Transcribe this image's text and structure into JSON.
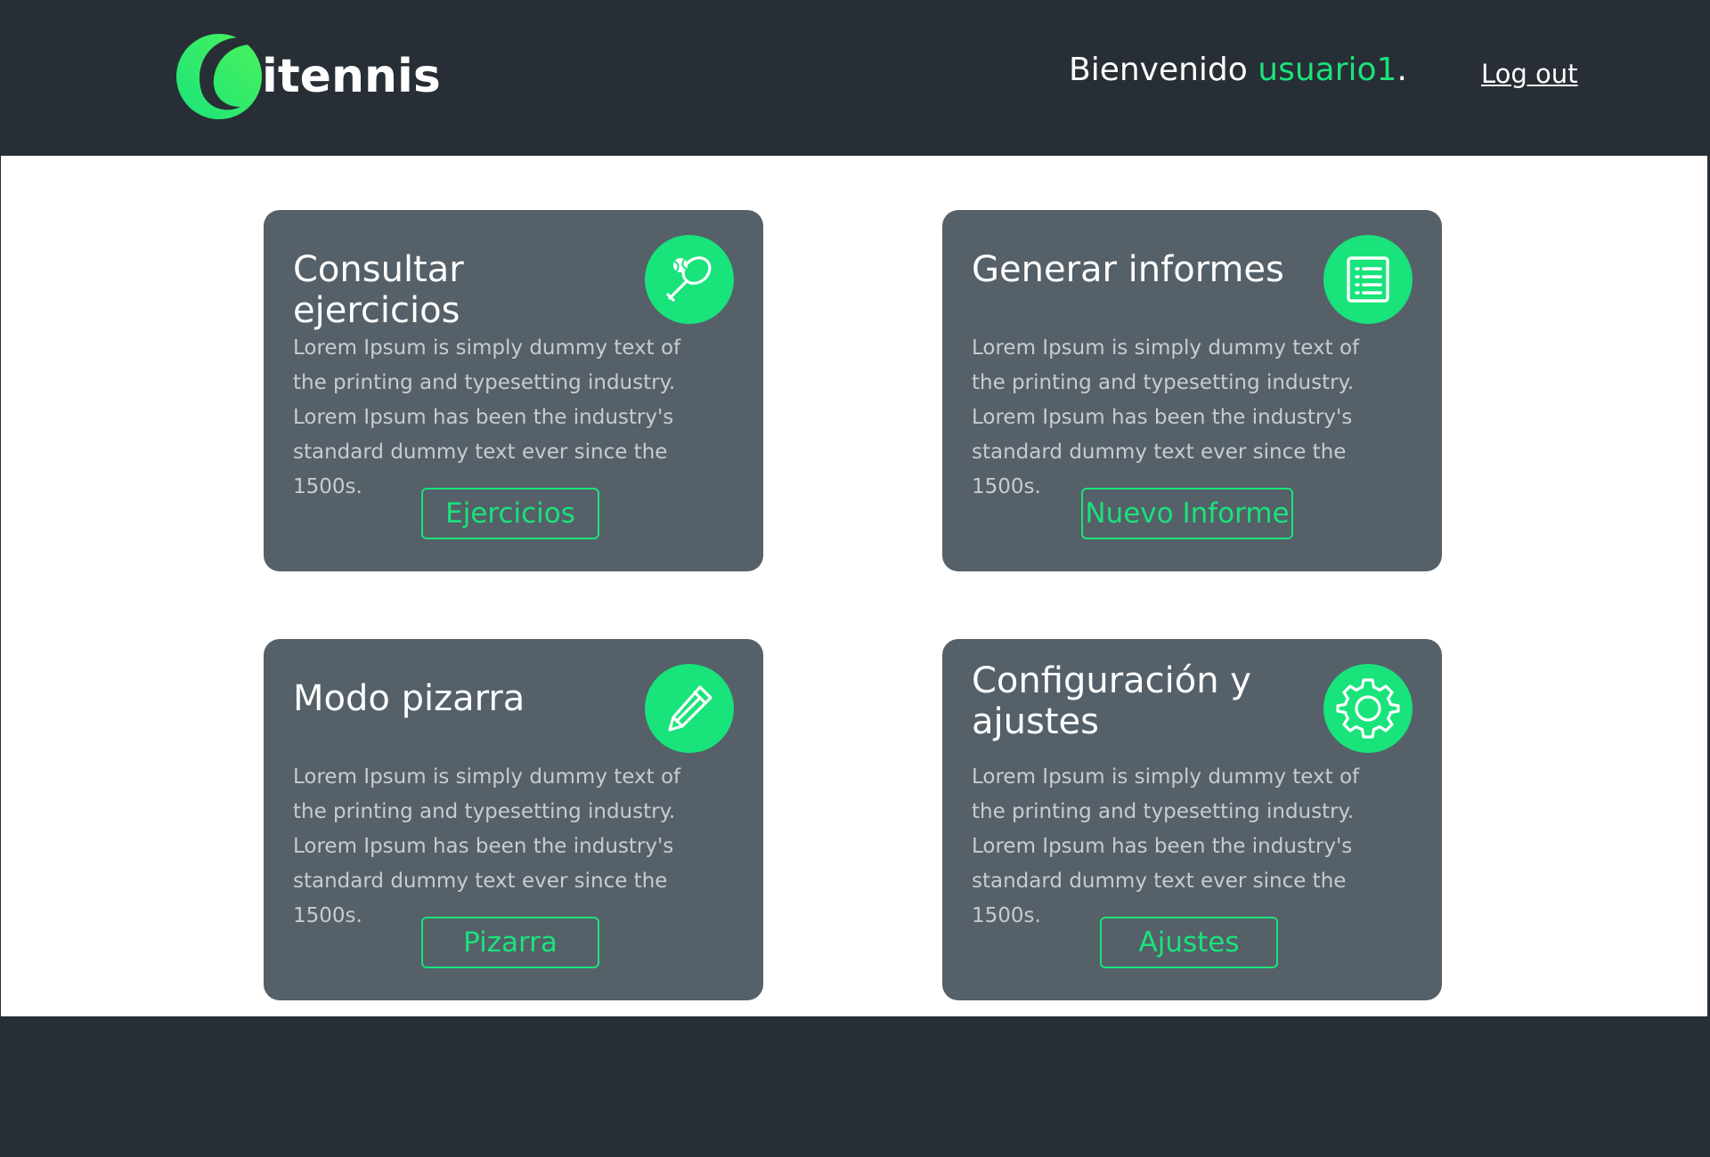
{
  "header": {
    "logo_text": "itennis",
    "welcome_prefix": "Bienvenido ",
    "username": "usuario1",
    "welcome_suffix": ".",
    "logout_label": "Log out"
  },
  "cards": [
    {
      "title": "Consultar ejercicios",
      "icon": "tennis-racket-icon",
      "description": "Lorem Ipsum is simply dummy text of the printing and typesetting industry. Lorem Ipsum has been the industry's standard dummy text ever since the 1500s.",
      "button_label": "Ejercicios"
    },
    {
      "title": "Generar informes",
      "icon": "report-list-icon",
      "description": "Lorem Ipsum is simply dummy text of the printing and typesetting industry. Lorem Ipsum has been the industry's standard dummy text ever since the 1500s.",
      "button_label": "Nuevo Informe"
    },
    {
      "title": "Modo pizarra",
      "icon": "pencil-icon",
      "description": "Lorem Ipsum is simply dummy text of the printing and typesetting industry. Lorem Ipsum has been the industry's standard dummy text ever since the 1500s.",
      "button_label": "Pizarra"
    },
    {
      "title": "Configuración y ajustes",
      "icon": "gear-icon",
      "description": "Lorem Ipsum is simply dummy text of the printing and typesetting industry. Lorem Ipsum has been the industry's standard dummy text ever since the 1500s.",
      "button_label": "Ajustes"
    }
  ],
  "colors": {
    "accent": "#19e37b",
    "header_bg": "#282e35",
    "card_bg": "#556069",
    "content_bg": "#ffffff"
  }
}
